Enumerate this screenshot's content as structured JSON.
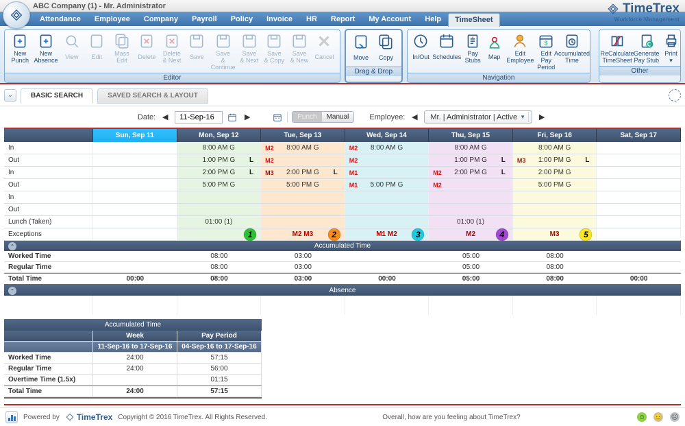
{
  "company_context": "ABC Company (1) - Mr. Administrator",
  "brand": {
    "name": "TimeTrex",
    "tagline": "Workforce Management"
  },
  "menu": [
    "Attendance",
    "Employee",
    "Company",
    "Payroll",
    "Policy",
    "Invoice",
    "HR",
    "Report",
    "My Account",
    "Help",
    "TimeSheet"
  ],
  "menu_active": "TimeSheet",
  "toolbar_groups": {
    "editor": {
      "caption": "Editor",
      "buttons": [
        {
          "id": "new-punch",
          "label": "New\nPunch",
          "enabled": true
        },
        {
          "id": "new-absence",
          "label": "New\nAbsence",
          "enabled": true
        },
        {
          "id": "view",
          "label": "View",
          "enabled": false
        },
        {
          "id": "edit",
          "label": "Edit",
          "enabled": false
        },
        {
          "id": "mass-edit",
          "label": "Mass\nEdit",
          "enabled": false
        },
        {
          "id": "delete",
          "label": "Delete",
          "enabled": false
        },
        {
          "id": "delete-next",
          "label": "Delete\n& Next",
          "enabled": false
        },
        {
          "id": "save",
          "label": "Save",
          "enabled": false
        },
        {
          "id": "save-continue",
          "label": "Save\n& Continue",
          "enabled": false
        },
        {
          "id": "save-next",
          "label": "Save\n& Next",
          "enabled": false
        },
        {
          "id": "save-copy",
          "label": "Save\n& Copy",
          "enabled": false
        },
        {
          "id": "save-new",
          "label": "Save\n& New",
          "enabled": false
        },
        {
          "id": "cancel",
          "label": "Cancel",
          "enabled": false
        }
      ]
    },
    "dragdrop": {
      "caption": "Drag & Drop",
      "buttons": [
        {
          "id": "move",
          "label": "Move",
          "enabled": true
        },
        {
          "id": "copy",
          "label": "Copy",
          "enabled": true
        }
      ]
    },
    "navigation": {
      "caption": "Navigation",
      "buttons": [
        {
          "id": "inout",
          "label": "In/Out",
          "enabled": true
        },
        {
          "id": "schedules",
          "label": "Schedules",
          "enabled": true
        },
        {
          "id": "pay-stubs",
          "label": "Pay\nStubs",
          "enabled": true
        },
        {
          "id": "map",
          "label": "Map",
          "enabled": true
        },
        {
          "id": "edit-employee",
          "label": "Edit\nEmployee",
          "enabled": true
        },
        {
          "id": "edit-pay-period",
          "label": "Edit Pay\nPeriod",
          "enabled": true
        },
        {
          "id": "accumulated-time",
          "label": "Accumulated\nTime",
          "enabled": true
        }
      ]
    },
    "other": {
      "caption": "Other",
      "buttons": [
        {
          "id": "recalculate",
          "label": "ReCalculate\nTimeSheet",
          "enabled": true
        },
        {
          "id": "generate-paystub",
          "label": "Generate\nPay Stub",
          "enabled": true
        },
        {
          "id": "print",
          "label": "Print\n▾",
          "enabled": true
        }
      ]
    }
  },
  "tabs": {
    "basic": "BASIC SEARCH",
    "saved": "SAVED SEARCH & LAYOUT",
    "active": "basic"
  },
  "pager": {
    "date_label": "Date:",
    "date_value": "11-Sep-16",
    "mode": {
      "punch": "Punch",
      "manual": "Manual",
      "selected": "manual"
    },
    "employee_label": "Employee:",
    "employee_value": "Mr. | Administrator | Active"
  },
  "days": [
    "Sun, Sep 11",
    "Mon, Sep 12",
    "Tue, Sep 13",
    "Wed, Sep 14",
    "Thu, Sep 15",
    "Fri, Sep 16",
    "Sat, Sep 17"
  ],
  "row_labels": [
    "In",
    "Out",
    "In",
    "Out",
    "In",
    "Out",
    "Lunch (Taken)",
    "Exceptions"
  ],
  "punches": {
    "mon": {
      "in1": "8:00 AM G",
      "out1": "1:00 PM G",
      "out1_L": "L",
      "in2": "2:00 PM G",
      "in2_L": "L",
      "out2": "5:00 PM G",
      "lunch": "01:00 (1)"
    },
    "tue": {
      "in1": "8:00 AM G",
      "in1_m": "M2",
      "out1": "",
      "out1_m": "M2",
      "in2": "2:00 PM G",
      "in2_m": "M3",
      "in2_L": "L",
      "out2": "5:00 PM G",
      "exc": "M2  M3"
    },
    "wed": {
      "in1": "8:00 AM G",
      "in1_m": "M2",
      "out1": "",
      "out1_m": "M2",
      "in2": "",
      "in2_m": "M1",
      "out2": "5:00 PM G",
      "out2_m": "M1",
      "exc": "M1  M2"
    },
    "thu": {
      "in1": "8:00 AM G",
      "out1": "1:00 PM G",
      "out1_L": "L",
      "in2": "2:00 PM G",
      "in2_m": "M2",
      "in2_L": "L",
      "out2": "",
      "out2_m": "M2",
      "lunch": "01:00 (1)",
      "exc": "M2"
    },
    "fri": {
      "in1": "8:00 AM G",
      "out1": "1:00 PM G",
      "out1_m": "M3",
      "out1_L": "L",
      "in2": "2:00 PM G",
      "out2": "5:00 PM G",
      "exc": "M3"
    }
  },
  "badges": {
    "mon": "1",
    "tue": "2",
    "wed": "3",
    "thu": "4",
    "fri": "5"
  },
  "accum": {
    "header": "Accumulated Time",
    "worked_label": "Worked Time",
    "regular_label": "Regular Time",
    "total_label": "Total Time",
    "worked": {
      "sun": "",
      "mon": "08:00",
      "tue": "03:00",
      "wed": "",
      "thu": "05:00",
      "fri": "08:00",
      "sat": ""
    },
    "regular": {
      "sun": "",
      "mon": "08:00",
      "tue": "03:00",
      "wed": "",
      "thu": "05:00",
      "fri": "08:00",
      "sat": ""
    },
    "total": {
      "sun": "00:00",
      "mon": "08:00",
      "tue": "03:00",
      "wed": "00:00",
      "thu": "05:00",
      "fri": "08:00",
      "sat": "00:00"
    }
  },
  "absence_header": "Absence",
  "accum_box": {
    "header": "Accumulated Time",
    "col1": "Week",
    "col2": "Pay Period",
    "range1": "11-Sep-16 to 17-Sep-16",
    "range2": "04-Sep-16 to 17-Sep-16",
    "rows": [
      {
        "label": "Worked Time",
        "v1": "24:00",
        "v2": "57:15"
      },
      {
        "label": "Regular Time",
        "v1": "24:00",
        "v2": "56:00"
      },
      {
        "label": "Overtime Time (1.5x)",
        "v1": "",
        "v2": "01:15"
      },
      {
        "label": "Total Time",
        "v1": "24:00",
        "v2": "57:15"
      }
    ]
  },
  "footer": {
    "powered": "Powered by",
    "brand": "TimeTrex",
    "copyright": "Copyright © 2016 TimeTrex. All Rights Reserved.",
    "feeling": "Overall, how are you feeling about TimeTrex?"
  }
}
